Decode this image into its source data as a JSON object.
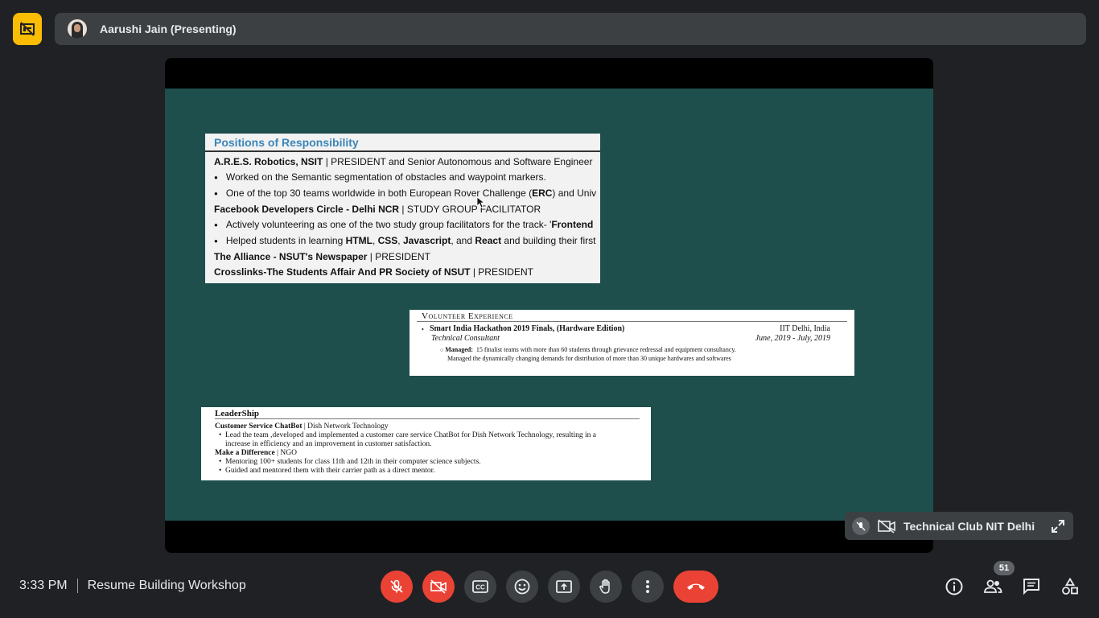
{
  "header": {
    "presenter_name": "Aarushi Jain (Presenting)",
    "badge_icon": "no-sync-icon",
    "badge_color": "#fbbc04"
  },
  "slide": {
    "background": "#1e4f4c",
    "card1": {
      "heading": "Positions of Responsibility",
      "l1_org": "A.R.E.S. Robotics, NSIT",
      "l1_role": " | PRESIDENT and Senior Autonomous and Software Engineer",
      "l2": "Worked on the Semantic segmentation of obstacles and waypoint markers.",
      "l3_a": "One of the top 30 teams worldwide in both European Rover Challenge (",
      "l3_b": "ERC",
      "l3_c": ") and Univ",
      "l4_org": "Facebook Developers Circle - Delhi NCR",
      "l4_role": " | STUDY GROUP FACILITATOR",
      "l5_a": "Actively volunteering as one of the two study group facilitators for the track- '",
      "l5_b": "Frontend",
      "l6_a": "Helped students in learning ",
      "l6_b": "HTML",
      "l6_c": ", ",
      "l6_d": "CSS",
      "l6_e": ", ",
      "l6_f": "Javascript",
      "l6_g": ", and ",
      "l6_h": "React",
      "l6_i": " and building their first",
      "l7_org": "The Alliance - NSUT's Newspaper",
      "l7_role": " | PRESIDENT",
      "l8_org": "Crosslinks-The Students Affair And PR Society of NSUT",
      "l8_role": " | PRESIDENT"
    },
    "card2": {
      "heading": "Volunteer Experience",
      "event": "Smart India Hackathon 2019 Finals, (Hardware Edition)",
      "location": "IIT Delhi, India",
      "role": "Technical Consultant",
      "dates": "June, 2019 - July, 2019",
      "managed_label": "Managed:",
      "managed_text": "15 finalist teams with more than 60 students through grievance redressal and equipment consultancy.",
      "managed_text2": "Managed the dynamically changing demands for distribution of more than 30 unique hardwares and softwares"
    },
    "card3": {
      "heading": "LeaderShip",
      "item1_title": "Customer Service ChatBot",
      "item1_org": " | Dish Network Technology",
      "item1_b1": "Lead the team ,developed and implemented a customer care service ChatBot for Dish Network Technology, resulting in a",
      "item1_b1_cont": "increase in efficiency and an improvement in customer satisfaction.",
      "item2_title": "Make a Difference",
      "item2_org": " | NGO",
      "item2_b1": "Mentoring 100+ students for class 11th and 12th in their computer science subjects.",
      "item2_b2": "Guided and mentored them with their carrier path as a direct mentor."
    }
  },
  "self_tile": {
    "name": "Technical Club NIT Delhi"
  },
  "footer": {
    "time": "3:33 PM",
    "meeting_title": "Resume Building Workshop",
    "participant_count": "51",
    "accent_red": "#ea4335"
  }
}
